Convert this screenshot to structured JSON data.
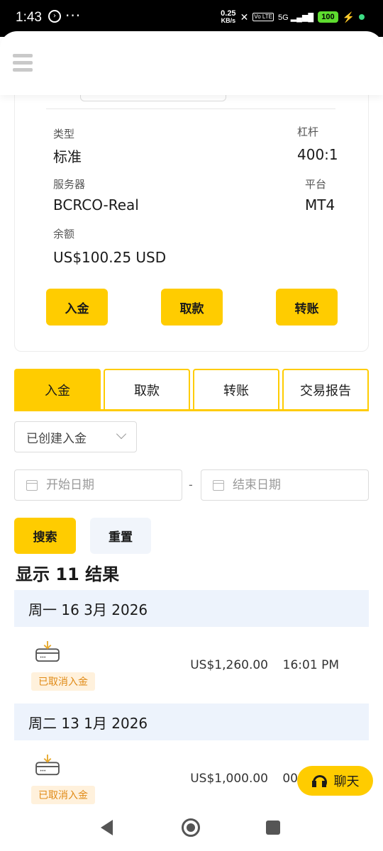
{
  "status_bar": {
    "time": "1:43",
    "nav_glyph": "›",
    "more": "···",
    "speed_value": "0.25",
    "speed_unit": "KB/s",
    "lte": "Vo LTE",
    "signal": "5G",
    "battery": "100"
  },
  "account": {
    "type_label": "类型",
    "type_value": "标准",
    "leverage_label": "杠杆",
    "leverage_value": "400:1",
    "server_label": "服务器",
    "server_value": "BCRCO-Real",
    "platform_label": "平台",
    "platform_value": "MT4",
    "balance_label": "余额",
    "balance_value": "US$100.25 USD",
    "buttons": {
      "deposit": "入金",
      "withdraw": "取款",
      "transfer": "转账"
    }
  },
  "tabs": [
    {
      "label": "入金",
      "active": true
    },
    {
      "label": "取款",
      "active": false
    },
    {
      "label": "转账",
      "active": false
    },
    {
      "label": "交易报告",
      "active": false
    }
  ],
  "filters": {
    "status_select": "已创建入金",
    "start_placeholder": "开始日期",
    "end_placeholder": "结束日期",
    "separator": "-",
    "search_label": "搜索",
    "reset_label": "重置"
  },
  "results_text": "显示 11 结果",
  "groups": [
    {
      "date": "周一 16 3月 2026",
      "items": [
        {
          "status": "已取消入金",
          "amount": "US$1,260.00",
          "time": "16:01 PM"
        }
      ]
    },
    {
      "date": "周二 13 1月 2026",
      "items": [
        {
          "status": "已取消入金",
          "amount": "US$1,000.00",
          "time": "00"
        }
      ]
    }
  ],
  "chat_label": "聊天",
  "colors": {
    "accent": "#ffcc00",
    "badge_text": "#e08a16",
    "badge_bg": "#fff1dc",
    "group_bg": "#edf3fc"
  }
}
